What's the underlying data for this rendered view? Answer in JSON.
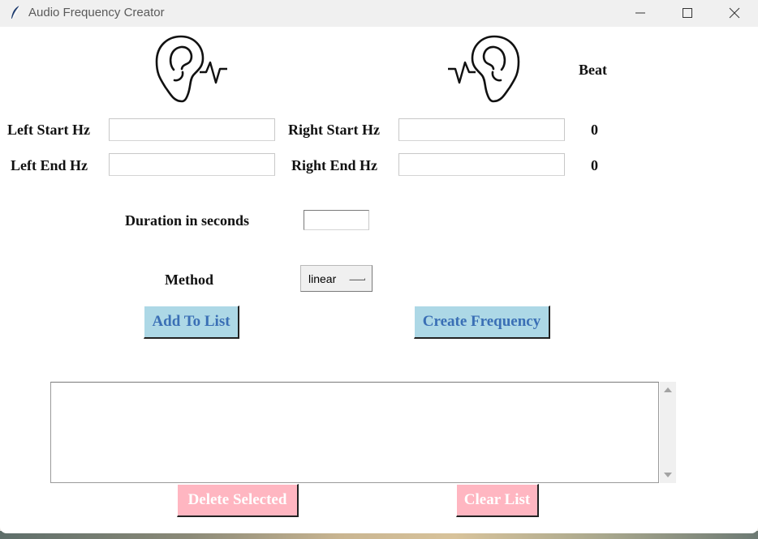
{
  "window": {
    "title": "Audio Frequency Creator",
    "app_icon": "feather-icon",
    "controls": [
      "minimize-icon",
      "maximize-icon",
      "close-icon"
    ]
  },
  "header": {
    "left_icon": "ear-left-soundwave-icon",
    "right_icon": "ear-right-soundwave-icon",
    "beat_label": "Beat"
  },
  "form": {
    "left_start_label": "Left Start Hz",
    "left_start_value": "",
    "right_start_label": "Right Start Hz",
    "right_start_value": "",
    "beat_start": "0",
    "left_end_label": "Left End Hz",
    "left_end_value": "",
    "right_end_label": "Right End Hz",
    "right_end_value": "",
    "beat_end": "0",
    "duration_label": "Duration in seconds",
    "duration_value": "",
    "method_label": "Method",
    "method_value": "linear"
  },
  "actions": {
    "add_label": "Add To List",
    "create_label": "Create Frequency",
    "delete_label": "Delete Selected",
    "clear_label": "Clear List"
  },
  "list": {
    "items": []
  },
  "colors": {
    "primary_button": "#add8e6",
    "primary_button_text": "#3a6fb5",
    "danger_button": "#ffb6c1",
    "danger_button_text": "#ffffff"
  }
}
